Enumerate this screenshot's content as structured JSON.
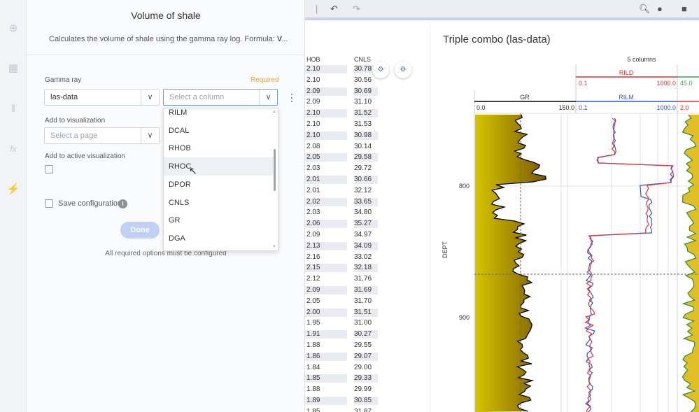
{
  "rail": {
    "icons": [
      "plus-circle-icon",
      "table-icon",
      "bar-chart-icon",
      "function-icon",
      "lightning-icon"
    ]
  },
  "panel": {
    "title": "Volume of shale",
    "description": "Calculates the volume of shale using the gamma ray log. Formula: V...",
    "gamma_ray_label": "Gamma ray",
    "required_label": "Required",
    "table_select_value": "las-data",
    "column_placeholder": "Select a column",
    "add_to_visualization_label": "Add to visualization",
    "page_placeholder": "Select a page",
    "add_to_active_label": "Add to active visualization",
    "save_config_label": "Save configuration",
    "done_label": "Done",
    "required_note": "All required options must be configured"
  },
  "dropdown": {
    "items": [
      "RILM",
      "DCAL",
      "RHOB",
      "RHOC",
      "DPOR",
      "CNLS",
      "GR",
      "DGA"
    ],
    "hover_index": 3
  },
  "table": {
    "headers": [
      "HOB",
      "CNLS"
    ],
    "rows": [
      [
        "2.10",
        "30.78"
      ],
      [
        "2.10",
        "30.56"
      ],
      [
        "2.09",
        "30.69"
      ],
      [
        "2.09",
        "31.10"
      ],
      [
        "2.10",
        "31.52"
      ],
      [
        "2.10",
        "31.53"
      ],
      [
        "2.10",
        "30.98"
      ],
      [
        "2.08",
        "30.14"
      ],
      [
        "2.05",
        "29.58"
      ],
      [
        "2.03",
        "29.72"
      ],
      [
        "2.01",
        "30.66"
      ],
      [
        "2.01",
        "32.12"
      ],
      [
        "2.02",
        "33.65"
      ],
      [
        "2.03",
        "34.80"
      ],
      [
        "2.06",
        "35.27"
      ],
      [
        "2.09",
        "34.97"
      ],
      [
        "2.13",
        "34.09"
      ],
      [
        "2.16",
        "33.02"
      ],
      [
        "2.15",
        "32.18"
      ],
      [
        "2.12",
        "31.76"
      ],
      [
        "2.09",
        "31.69"
      ],
      [
        "2.05",
        "31.70"
      ],
      [
        "2.00",
        "31.51"
      ],
      [
        "1.95",
        "31.00"
      ],
      [
        "1.91",
        "30.27"
      ],
      [
        "1.88",
        "29.55"
      ],
      [
        "1.86",
        "29.07"
      ],
      [
        "1.84",
        "29.00"
      ],
      [
        "1.85",
        "29.33"
      ],
      [
        "1.88",
        "29.99"
      ],
      [
        "1.89",
        "30.85"
      ],
      [
        "1.85",
        "31.87"
      ]
    ]
  },
  "chart": {
    "title": "Triple combo (las-data)",
    "columns_label": "5 columns",
    "depth_axis_label": "DEPT",
    "depth_ticks": [
      "800",
      "900"
    ]
  },
  "chart_data": {
    "type": "line",
    "tracks": [
      {
        "name": "GR",
        "min": "0.0",
        "max": "150.0",
        "color": "#000000"
      },
      {
        "name": "RILM",
        "min": "0.1",
        "max": "1000.0",
        "color": "#3355dd"
      },
      {
        "name": "RILD",
        "min": "0.1",
        "max": "1000.0",
        "color": "#dd3333"
      },
      {
        "name": "",
        "min": "45.0",
        "max": "",
        "color": "#33aa55"
      },
      {
        "name": "",
        "min": "2.0",
        "max": "",
        "color": "#dd3333"
      }
    ],
    "ylabel": "DEPT",
    "yticks": [
      800,
      900
    ]
  },
  "colors": {
    "accent": "#6c9ad4",
    "required": "#f0a330",
    "done_button": "#bfd0f4",
    "gr_fill": "#c9b400"
  }
}
